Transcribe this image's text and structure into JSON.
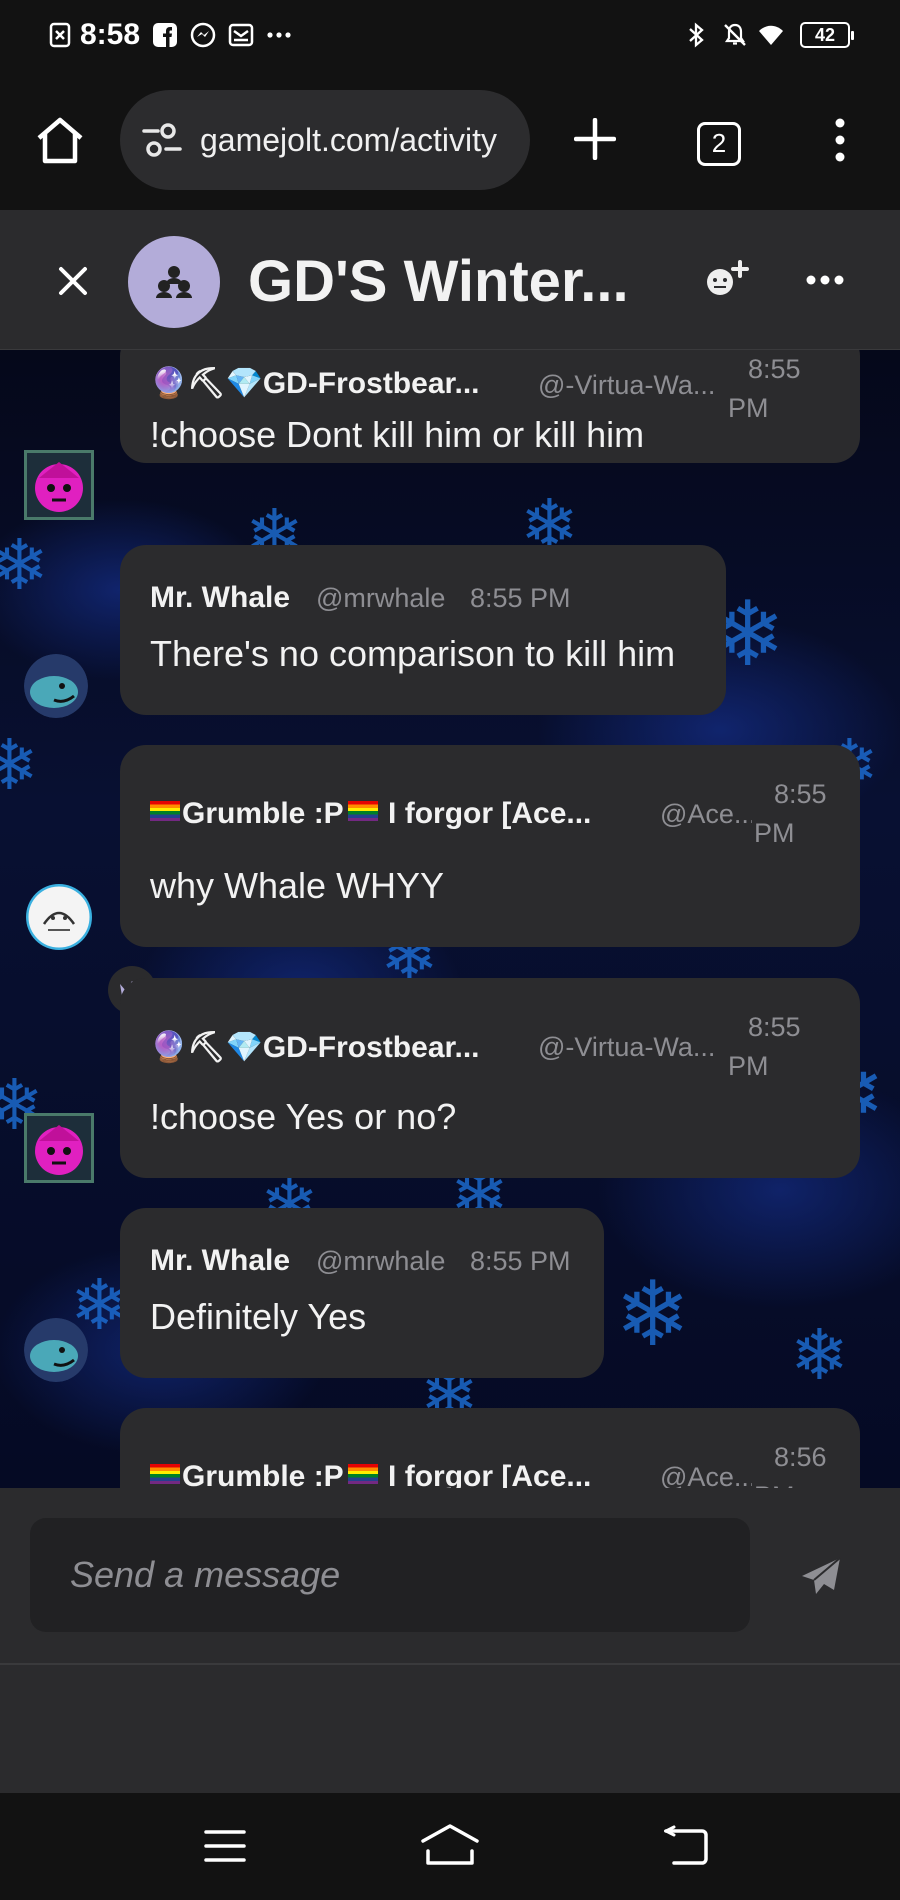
{
  "status_bar": {
    "time": "8:58",
    "battery": "42",
    "left_icons": [
      "screenshot-icon",
      "facebook-icon",
      "messenger-icon",
      "mail-icon",
      "more-dots-icon"
    ],
    "right_icons": [
      "bluetooth-icon",
      "mute-icon",
      "wifi-icon"
    ]
  },
  "browser": {
    "url": "gamejolt.com/activity",
    "tab_count": "2"
  },
  "chat": {
    "title": "GD'S Winter...",
    "messages": [
      {
        "name": "GD-Frostbear...",
        "handle": "@-Virtua-Wa...",
        "time_line1": "8:55",
        "time_line2": "PM",
        "text": "!choose Dont kill him or kill him"
      },
      {
        "name": "Mr. Whale",
        "handle": "@mrwhale",
        "time": "8:55 PM",
        "text": "There's no comparison to kill him"
      },
      {
        "name": "Grumble :P",
        "name_suffix": "I forgor [Ace...",
        "handle": "@Ace...",
        "time_line1": "8:55",
        "time_line2": "PM",
        "text": "why Whale WHYY"
      },
      {
        "name": "GD-Frostbear...",
        "handle": "@-Virtua-Wa...",
        "time_line1": "8:55",
        "time_line2": "PM",
        "text": "!choose Yes or no?"
      },
      {
        "name": "Mr. Whale",
        "handle": "@mrwhale",
        "time": "8:55 PM",
        "text": "Definitely Yes"
      },
      {
        "name": "Grumble :P",
        "name_suffix": "I forgor [Ace...",
        "handle": "@Ace...",
        "time_line1": "8:56",
        "time_line2": "PM",
        "text": ""
      }
    ]
  },
  "composer": {
    "placeholder": "Send a message"
  },
  "colors": {
    "bubble": "#2b2b2d",
    "background": "#121212",
    "accent_avatar": "#b3acd9",
    "snow_blue": "#1d6fd6"
  }
}
